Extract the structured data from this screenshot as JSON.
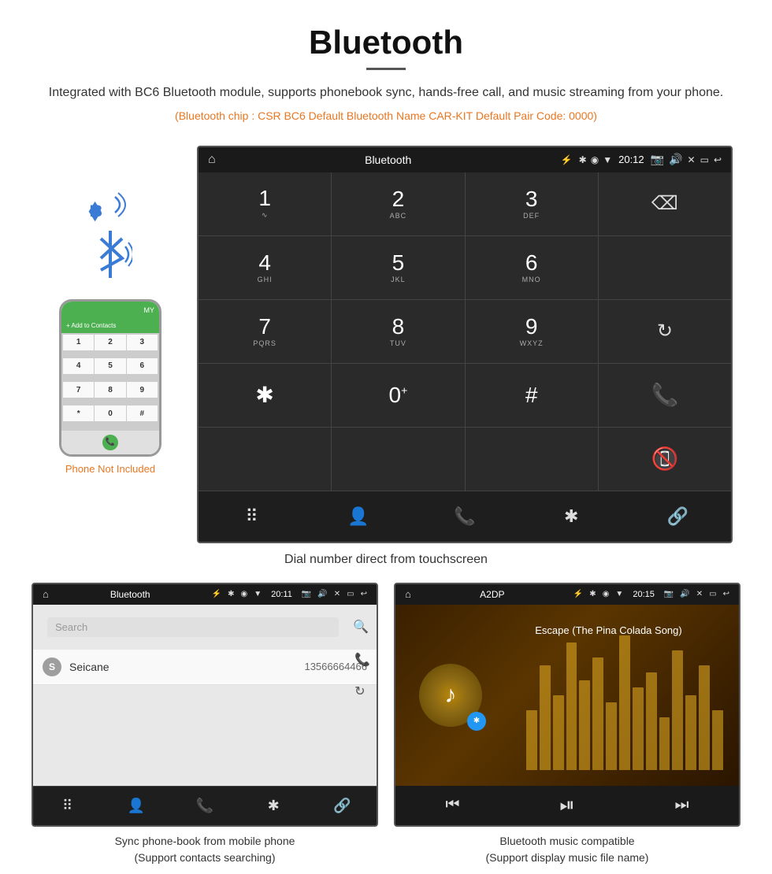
{
  "header": {
    "title": "Bluetooth",
    "description": "Integrated with BC6 Bluetooth module, supports phonebook sync, hands-free call, and music streaming from your phone.",
    "specs": "(Bluetooth chip : CSR BC6    Default Bluetooth Name CAR-KIT    Default Pair Code: 0000)"
  },
  "main_screen": {
    "app_name": "Bluetooth",
    "time": "20:12",
    "dialpad": {
      "keys": [
        {
          "num": "1",
          "letters": ""
        },
        {
          "num": "2",
          "letters": "ABC"
        },
        {
          "num": "3",
          "letters": "DEF"
        },
        {
          "num": "",
          "letters": ""
        },
        {
          "num": "4",
          "letters": "GHI"
        },
        {
          "num": "5",
          "letters": "JKL"
        },
        {
          "num": "6",
          "letters": "MNO"
        },
        {
          "num": "",
          "letters": ""
        },
        {
          "num": "7",
          "letters": "PQRS"
        },
        {
          "num": "8",
          "letters": "TUV"
        },
        {
          "num": "9",
          "letters": "WXYZ"
        },
        {
          "num": "",
          "letters": ""
        },
        {
          "num": "*",
          "letters": ""
        },
        {
          "num": "0",
          "letters": ""
        },
        {
          "num": "#",
          "letters": ""
        },
        {
          "num": "",
          "letters": ""
        }
      ]
    }
  },
  "main_caption": "Dial number direct from touchscreen",
  "phone_not_included": "Phone Not Included",
  "phonebook_screen": {
    "app_name": "Bluetooth",
    "time": "20:11",
    "search_placeholder": "Search",
    "contacts": [
      {
        "letter": "S",
        "name": "Seicane",
        "number": "13566664466"
      }
    ]
  },
  "music_screen": {
    "app_name": "A2DP",
    "time": "20:15",
    "song_title": "Escape (The Pina Colada Song)"
  },
  "phonebook_caption": {
    "line1": "Sync phone-book from mobile phone",
    "line2": "(Support contacts searching)"
  },
  "music_caption": {
    "line1": "Bluetooth music compatible",
    "line2": "(Support display music file name)"
  },
  "toolbar": {
    "icons": [
      "⠿",
      "👤",
      "📞",
      "✱",
      "🔗"
    ]
  }
}
